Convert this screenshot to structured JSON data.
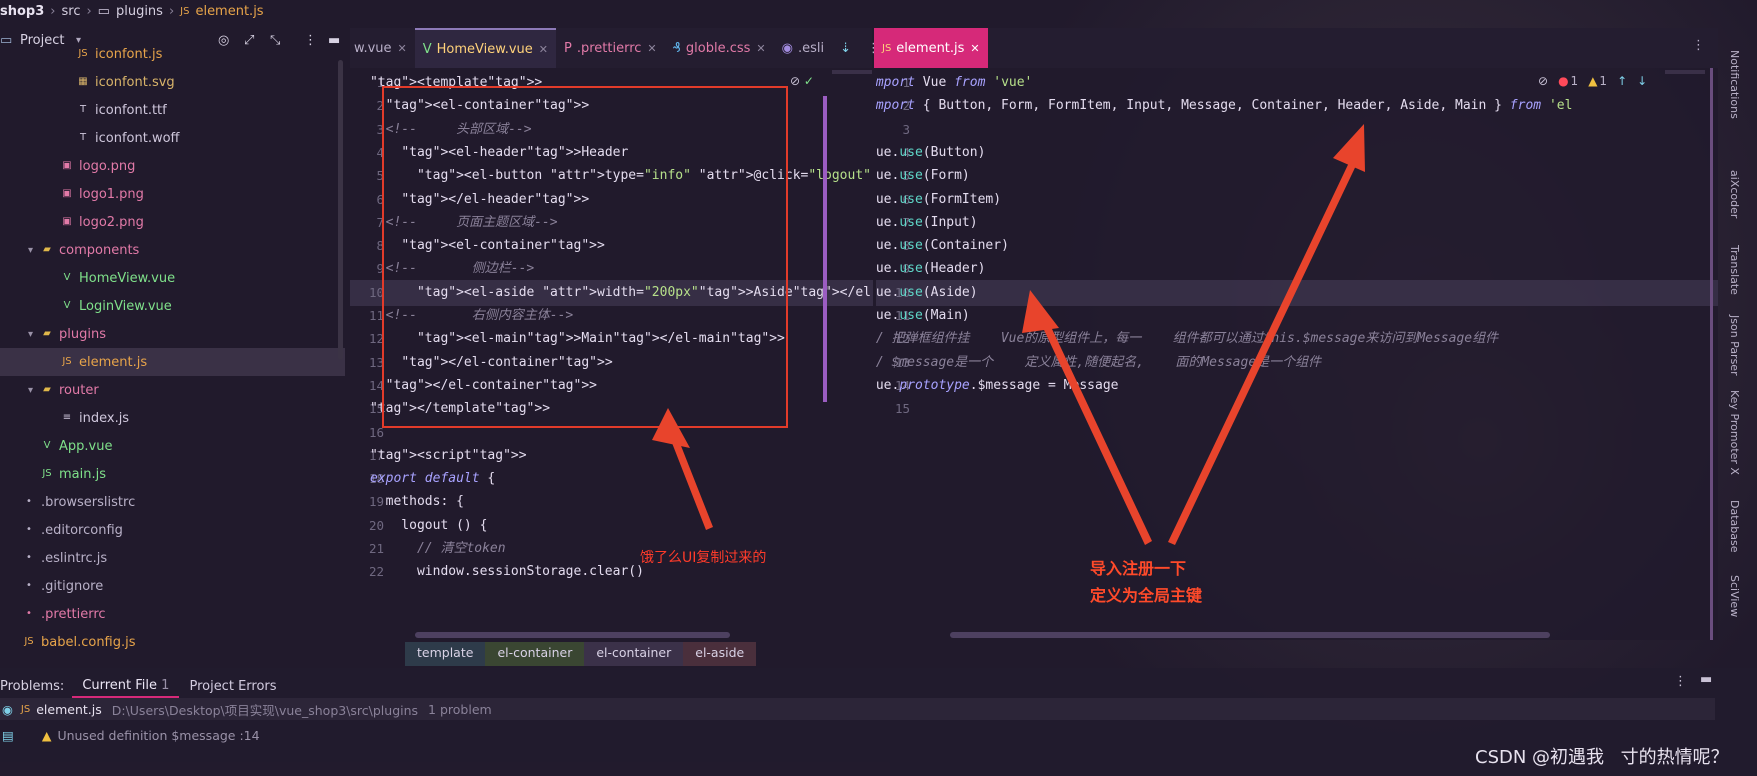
{
  "breadcrumb": {
    "project": "shop3",
    "src": "src",
    "folder": "plugins",
    "file": "element.js"
  },
  "project_panel": {
    "title": "Project",
    "view_icon": "chevron-down-icon"
  },
  "tree": [
    {
      "label": "iconfont.js",
      "color": "#e7a44a"
    },
    {
      "label": "iconfont.svg",
      "color": "#d9b46a"
    },
    {
      "label": "iconfont.ttf",
      "color": "#cfc7dc"
    },
    {
      "label": "iconfont.woff",
      "color": "#cfc7dc"
    },
    {
      "label": "logo.png",
      "color": "#e27aa8"
    },
    {
      "label": "logo1.png",
      "color": "#e27aa8"
    },
    {
      "label": "logo2.png",
      "color": "#e27aa8"
    },
    {
      "label": "components",
      "color": "#e27aa8"
    },
    {
      "label": "HomeView.vue",
      "color": "#7fe08a"
    },
    {
      "label": "LoginView.vue",
      "color": "#7fe08a"
    },
    {
      "label": "plugins",
      "color": "#e27aa8"
    },
    {
      "label": "element.js",
      "color": "#e7a44a"
    },
    {
      "label": "router",
      "color": "#e27aa8"
    },
    {
      "label": "index.js",
      "color": "#cfc7dc"
    },
    {
      "label": "App.vue",
      "color": "#7fe08a"
    },
    {
      "label": "main.js",
      "color": "#7fe08a"
    },
    {
      "label": ".browserslistrc",
      "color": "#b9b1c8"
    },
    {
      "label": ".editorconfig",
      "color": "#b9b1c8"
    },
    {
      "label": ".eslintrc.js",
      "color": "#b9b1c8"
    },
    {
      "label": ".gitignore",
      "color": "#b9b1c8"
    },
    {
      "label": ".prettierrc",
      "color": "#e27aa8"
    },
    {
      "label": "babel.config.js",
      "color": "#e7a44a"
    }
  ],
  "left_tabs": [
    {
      "label": "w.vue",
      "active": false
    },
    {
      "label": "HomeView.vue",
      "active": true
    },
    {
      "label": ".prettierrc",
      "active": false
    },
    {
      "label": "globle.css",
      "active": false
    },
    {
      "label": ".esli",
      "active": false
    }
  ],
  "right_tabs": [
    {
      "label": "element.js",
      "active": true
    }
  ],
  "left_code": [
    {
      "n": "1",
      "text": "<template>"
    },
    {
      "n": "2",
      "text": "  <el-container>"
    },
    {
      "n": "3",
      "text": "  <!--     头部区域-->"
    },
    {
      "n": "4",
      "text": "    <el-header>Header"
    },
    {
      "n": "5",
      "text": "      <el-button type=\"info\" @click=\"logout\">退出</el"
    },
    {
      "n": "6",
      "text": "    </el-header>"
    },
    {
      "n": "7",
      "text": "  <!--     页面主题区域-->"
    },
    {
      "n": "8",
      "text": "    <el-container>"
    },
    {
      "n": "9",
      "text": "  <!--       侧边栏-->"
    },
    {
      "n": "10",
      "text": "      <el-aside width=\"200px\">Aside</el-aside>"
    },
    {
      "n": "11",
      "text": "  <!--       右侧内容主体-->"
    },
    {
      "n": "12",
      "text": "      <el-main>Main</el-main>"
    },
    {
      "n": "13",
      "text": "    </el-container>"
    },
    {
      "n": "14",
      "text": "  </el-container>"
    },
    {
      "n": "15",
      "text": "</template>"
    },
    {
      "n": "16",
      "text": ""
    },
    {
      "n": "17",
      "text": "<script>"
    },
    {
      "n": "18",
      "text": "export default {"
    },
    {
      "n": "19",
      "text": "  methods: {"
    },
    {
      "n": "20",
      "text": "    logout () {"
    },
    {
      "n": "21",
      "text": "      // 清空token"
    },
    {
      "n": "22",
      "text": "      window.sessionStorage.clear()"
    }
  ],
  "right_code": [
    {
      "n": "1",
      "text": "import Vue from 'vue'"
    },
    {
      "n": "2",
      "text": "import { Button, Form, FormItem, Input, Message, Container, Header, Aside, Main } from 'el"
    },
    {
      "n": "3",
      "text": ""
    },
    {
      "n": "4",
      "text": "Vue.use(Button)"
    },
    {
      "n": "5",
      "text": "Vue.use(Form)"
    },
    {
      "n": "6",
      "text": "Vue.use(FormItem)"
    },
    {
      "n": "7",
      "text": "Vue.use(Input)"
    },
    {
      "n": "8",
      "text": "Vue.use(Container)"
    },
    {
      "n": "9",
      "text": "Vue.use(Header)"
    },
    {
      "n": "10",
      "text": "Vue.use(Aside)"
    },
    {
      "n": "11",
      "text": "Vue.use(Main)"
    },
    {
      "n": "12",
      "text": "// 把弹框组件挂    Vue的原型组件上，每一    组件都可以通过this.$message来访问到Message组件"
    },
    {
      "n": "13",
      "text": "// $message是一个    定义属性,随便起名,    面的Message是一个组件"
    },
    {
      "n": "14",
      "text": "Vue.prototype.$message = Message"
    },
    {
      "n": "15",
      "text": ""
    }
  ],
  "inspection": {
    "errors": "1",
    "warnings": "1"
  },
  "annotations": {
    "left": "饿了么UI复制过来的",
    "right_line1": "导入注册一下",
    "right_line2": "定义为全局主键"
  },
  "code_crumbs": [
    "template",
    "el-container",
    "el-container",
    "el-aside"
  ],
  "problems": {
    "label": "Problems:",
    "tabs": [
      {
        "label": "Current File",
        "count": "1"
      },
      {
        "label": "Project Errors",
        "count": ""
      }
    ],
    "file": "element.js",
    "path": "D:\\Users\\Desktop\\项目实现\\vue_shop3\\src\\plugins",
    "summary": "1 problem",
    "item": "Unused definition $message :14"
  },
  "right_sidebar": [
    "Notifications",
    "aiXcoder",
    "Translate",
    "Json Parser",
    "Key Promoter X",
    "Database",
    "SciView"
  ],
  "watermark": "CSDN @初遇我ㅤ寸的热情呢？"
}
